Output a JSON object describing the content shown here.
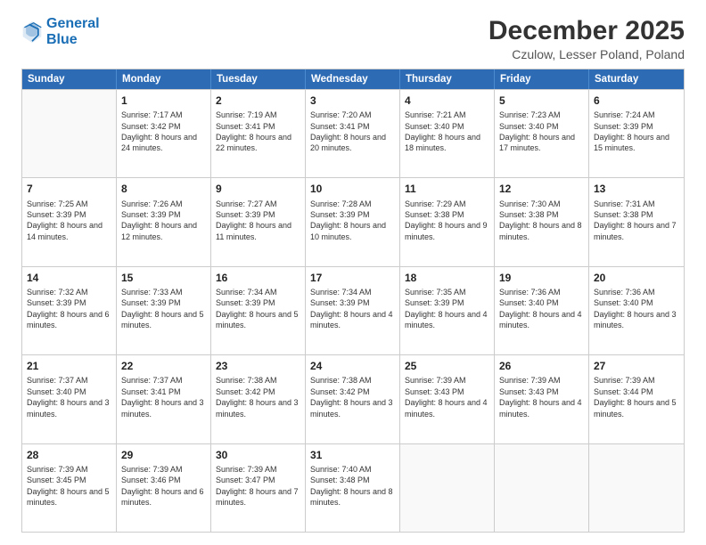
{
  "logo": {
    "line1": "General",
    "line2": "Blue"
  },
  "title": "December 2025",
  "subtitle": "Czulow, Lesser Poland, Poland",
  "header_days": [
    "Sunday",
    "Monday",
    "Tuesday",
    "Wednesday",
    "Thursday",
    "Friday",
    "Saturday"
  ],
  "weeks": [
    [
      {
        "day": "",
        "sunrise": "",
        "sunset": "",
        "daylight": ""
      },
      {
        "day": "1",
        "sunrise": "Sunrise: 7:17 AM",
        "sunset": "Sunset: 3:42 PM",
        "daylight": "Daylight: 8 hours and 24 minutes."
      },
      {
        "day": "2",
        "sunrise": "Sunrise: 7:19 AM",
        "sunset": "Sunset: 3:41 PM",
        "daylight": "Daylight: 8 hours and 22 minutes."
      },
      {
        "day": "3",
        "sunrise": "Sunrise: 7:20 AM",
        "sunset": "Sunset: 3:41 PM",
        "daylight": "Daylight: 8 hours and 20 minutes."
      },
      {
        "day": "4",
        "sunrise": "Sunrise: 7:21 AM",
        "sunset": "Sunset: 3:40 PM",
        "daylight": "Daylight: 8 hours and 18 minutes."
      },
      {
        "day": "5",
        "sunrise": "Sunrise: 7:23 AM",
        "sunset": "Sunset: 3:40 PM",
        "daylight": "Daylight: 8 hours and 17 minutes."
      },
      {
        "day": "6",
        "sunrise": "Sunrise: 7:24 AM",
        "sunset": "Sunset: 3:39 PM",
        "daylight": "Daylight: 8 hours and 15 minutes."
      }
    ],
    [
      {
        "day": "7",
        "sunrise": "Sunrise: 7:25 AM",
        "sunset": "Sunset: 3:39 PM",
        "daylight": "Daylight: 8 hours and 14 minutes."
      },
      {
        "day": "8",
        "sunrise": "Sunrise: 7:26 AM",
        "sunset": "Sunset: 3:39 PM",
        "daylight": "Daylight: 8 hours and 12 minutes."
      },
      {
        "day": "9",
        "sunrise": "Sunrise: 7:27 AM",
        "sunset": "Sunset: 3:39 PM",
        "daylight": "Daylight: 8 hours and 11 minutes."
      },
      {
        "day": "10",
        "sunrise": "Sunrise: 7:28 AM",
        "sunset": "Sunset: 3:39 PM",
        "daylight": "Daylight: 8 hours and 10 minutes."
      },
      {
        "day": "11",
        "sunrise": "Sunrise: 7:29 AM",
        "sunset": "Sunset: 3:38 PM",
        "daylight": "Daylight: 8 hours and 9 minutes."
      },
      {
        "day": "12",
        "sunrise": "Sunrise: 7:30 AM",
        "sunset": "Sunset: 3:38 PM",
        "daylight": "Daylight: 8 hours and 8 minutes."
      },
      {
        "day": "13",
        "sunrise": "Sunrise: 7:31 AM",
        "sunset": "Sunset: 3:38 PM",
        "daylight": "Daylight: 8 hours and 7 minutes."
      }
    ],
    [
      {
        "day": "14",
        "sunrise": "Sunrise: 7:32 AM",
        "sunset": "Sunset: 3:39 PM",
        "daylight": "Daylight: 8 hours and 6 minutes."
      },
      {
        "day": "15",
        "sunrise": "Sunrise: 7:33 AM",
        "sunset": "Sunset: 3:39 PM",
        "daylight": "Daylight: 8 hours and 5 minutes."
      },
      {
        "day": "16",
        "sunrise": "Sunrise: 7:34 AM",
        "sunset": "Sunset: 3:39 PM",
        "daylight": "Daylight: 8 hours and 5 minutes."
      },
      {
        "day": "17",
        "sunrise": "Sunrise: 7:34 AM",
        "sunset": "Sunset: 3:39 PM",
        "daylight": "Daylight: 8 hours and 4 minutes."
      },
      {
        "day": "18",
        "sunrise": "Sunrise: 7:35 AM",
        "sunset": "Sunset: 3:39 PM",
        "daylight": "Daylight: 8 hours and 4 minutes."
      },
      {
        "day": "19",
        "sunrise": "Sunrise: 7:36 AM",
        "sunset": "Sunset: 3:40 PM",
        "daylight": "Daylight: 8 hours and 4 minutes."
      },
      {
        "day": "20",
        "sunrise": "Sunrise: 7:36 AM",
        "sunset": "Sunset: 3:40 PM",
        "daylight": "Daylight: 8 hours and 3 minutes."
      }
    ],
    [
      {
        "day": "21",
        "sunrise": "Sunrise: 7:37 AM",
        "sunset": "Sunset: 3:40 PM",
        "daylight": "Daylight: 8 hours and 3 minutes."
      },
      {
        "day": "22",
        "sunrise": "Sunrise: 7:37 AM",
        "sunset": "Sunset: 3:41 PM",
        "daylight": "Daylight: 8 hours and 3 minutes."
      },
      {
        "day": "23",
        "sunrise": "Sunrise: 7:38 AM",
        "sunset": "Sunset: 3:42 PM",
        "daylight": "Daylight: 8 hours and 3 minutes."
      },
      {
        "day": "24",
        "sunrise": "Sunrise: 7:38 AM",
        "sunset": "Sunset: 3:42 PM",
        "daylight": "Daylight: 8 hours and 3 minutes."
      },
      {
        "day": "25",
        "sunrise": "Sunrise: 7:39 AM",
        "sunset": "Sunset: 3:43 PM",
        "daylight": "Daylight: 8 hours and 4 minutes."
      },
      {
        "day": "26",
        "sunrise": "Sunrise: 7:39 AM",
        "sunset": "Sunset: 3:43 PM",
        "daylight": "Daylight: 8 hours and 4 minutes."
      },
      {
        "day": "27",
        "sunrise": "Sunrise: 7:39 AM",
        "sunset": "Sunset: 3:44 PM",
        "daylight": "Daylight: 8 hours and 5 minutes."
      }
    ],
    [
      {
        "day": "28",
        "sunrise": "Sunrise: 7:39 AM",
        "sunset": "Sunset: 3:45 PM",
        "daylight": "Daylight: 8 hours and 5 minutes."
      },
      {
        "day": "29",
        "sunrise": "Sunrise: 7:39 AM",
        "sunset": "Sunset: 3:46 PM",
        "daylight": "Daylight: 8 hours and 6 minutes."
      },
      {
        "day": "30",
        "sunrise": "Sunrise: 7:39 AM",
        "sunset": "Sunset: 3:47 PM",
        "daylight": "Daylight: 8 hours and 7 minutes."
      },
      {
        "day": "31",
        "sunrise": "Sunrise: 7:40 AM",
        "sunset": "Sunset: 3:48 PM",
        "daylight": "Daylight: 8 hours and 8 minutes."
      },
      {
        "day": "",
        "sunrise": "",
        "sunset": "",
        "daylight": ""
      },
      {
        "day": "",
        "sunrise": "",
        "sunset": "",
        "daylight": ""
      },
      {
        "day": "",
        "sunrise": "",
        "sunset": "",
        "daylight": ""
      }
    ]
  ]
}
